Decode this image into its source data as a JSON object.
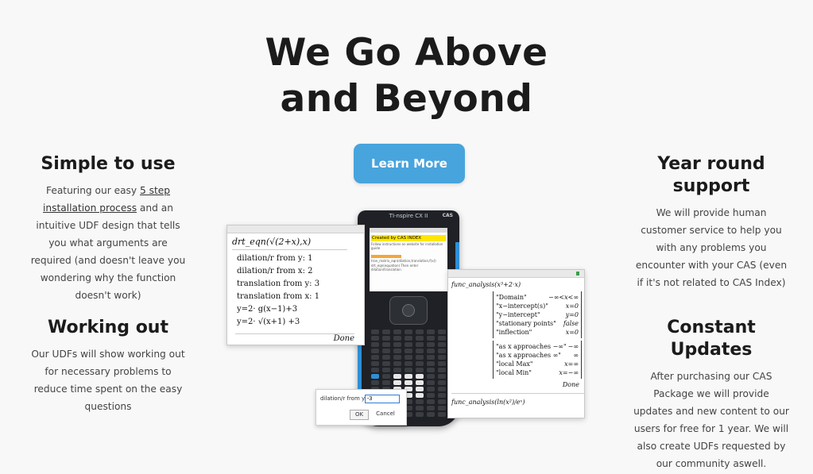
{
  "hero": {
    "title_line1": "We Go Above",
    "title_line2": "and Beyond",
    "cta_label": "Learn More"
  },
  "features": {
    "simple": {
      "heading": "Simple to use",
      "text_before": "Featuring our easy ",
      "link": "5 step installation process",
      "text_after": " and an intuitive UDF design that tells you what arguments are required (and doesn't leave you wondering why the function doesn't work)"
    },
    "working": {
      "heading": "Working out",
      "text": "Our UDFs will show working out for necessary problems to reduce time spent on the easy questions"
    },
    "support": {
      "heading_line1": "Year round",
      "heading_line2": "support",
      "text": "We will provide human customer service to help you with any problems you encounter with your CAS (even if it's not related to CAS Index)"
    },
    "updates": {
      "heading": "Constant Updates",
      "text": "After purchasing our CAS Package we will provide updates and new content to our users for free for 1 year. We will also create UDFs requested by our community aswell."
    }
  },
  "calculator": {
    "brand": "TI-nspire CX II",
    "cas": "CAS",
    "screen_caption": "Created by CAS INDEX",
    "screen_line": "Follow instructions on website for installation guide",
    "screen_fn1": "tran_matrix_eqn(dilation,translation,f(x))",
    "screen_fn2": "drt_eqn(equation) Then enter dilation/translation"
  },
  "window_left": {
    "header": "drt_eqn(√(2+x),x)",
    "rows": [
      "dilation/r from y: 1",
      "dilation/r from x: 2",
      "translation from y: 3",
      "translation from x: 1",
      "y=2· g(x−1)+3",
      "y=2· √(x+1) +3"
    ],
    "done": "Done"
  },
  "window_right": {
    "header": "func_analysis(x³+2·x)",
    "rows": [
      [
        "\"Domain\"",
        "−∞<x<∞"
      ],
      [
        "\"x−intercept(s)\"",
        "x=0"
      ],
      [
        "\"y−intercept\"",
        "y=0"
      ],
      [
        "\"stationary points\"",
        "false"
      ],
      [
        "\"inflection\"",
        "x=0"
      ]
    ],
    "rows2": [
      [
        "\"as x approaches −∞\"",
        "−∞"
      ],
      [
        "\"as x approaches ∞\"",
        "∞"
      ],
      [
        "\"local Max\"",
        "x=∞"
      ],
      [
        "\"local Min\"",
        "x=−∞"
      ]
    ],
    "done": "Done",
    "footer": "func_analysis(ln(x²)/eˣ)"
  },
  "dialog": {
    "label": "dilation/r from y:",
    "value": "-3",
    "ok": "OK",
    "cancel": "Cancel"
  },
  "colors": {
    "accent": "#48a4dc",
    "title": "#1b1b1b",
    "background": "#f8f8f8"
  }
}
